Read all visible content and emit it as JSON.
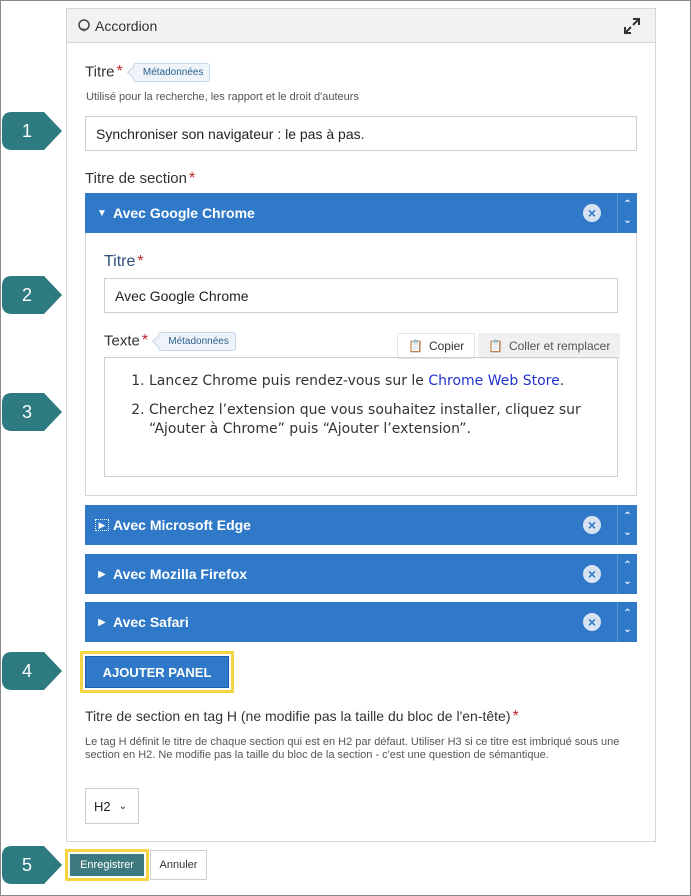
{
  "panel": {
    "title": "Accordion",
    "icon": "accordion-icon",
    "expand_icon": "expand-icon"
  },
  "titre": {
    "label": "Titre",
    "required": "*",
    "badge": "Métadonnées",
    "help": "Utilisé pour la recherche, les rapport et le droit d'auteurs",
    "value": "Synchroniser son navigateur : le pas à pas."
  },
  "section_title": {
    "label": "Titre de section",
    "required": "*"
  },
  "sections": [
    {
      "name": "Avec Google Chrome",
      "expanded": true
    },
    {
      "name": "Avec Microsoft Edge",
      "expanded": false
    },
    {
      "name": "Avec Mozilla Firefox",
      "expanded": false
    },
    {
      "name": "Avec Safari",
      "expanded": false
    }
  ],
  "section_body": {
    "title_label": "Titre",
    "title_required": "*",
    "title_value": "Avec Google Chrome",
    "text_label": "Texte",
    "text_required": "*",
    "text_badge": "Métadonnées",
    "copy_label": "Copier",
    "paste_label": "Coller et remplacer",
    "item1_prefix": "Lancez Chrome puis rendez-vous sur le ",
    "item1_link": "Chrome Web Store",
    "item1_suffix": ".",
    "item2": "Cherchez l’extension que vous souhaitez installer, cliquez sur “Ajouter à Chrome” puis “Ajouter l’extension”."
  },
  "add_panel_label": "AJOUTER PANEL",
  "htag": {
    "label": "Titre de section en tag H (ne modifie pas la taille du bloc de l'en-tête)",
    "required": "*",
    "help": "Le tag H définit le titre de chaque section qui est en H2 par défaut. Utiliser H3 si ce titre est imbriqué sous une section en H2. Ne modifie pas la taille du bloc de la section - c'est une question de sémantique.",
    "value": "H2"
  },
  "actions": {
    "save": "Enregistrer",
    "cancel": "Annuler"
  },
  "steps": [
    "1",
    "2",
    "3",
    "4",
    "5"
  ],
  "colors": {
    "accordion_bar": "#2f79c8",
    "step_marker": "#2d7a80",
    "highlight": "#f3d443",
    "required": "#c0282d"
  }
}
